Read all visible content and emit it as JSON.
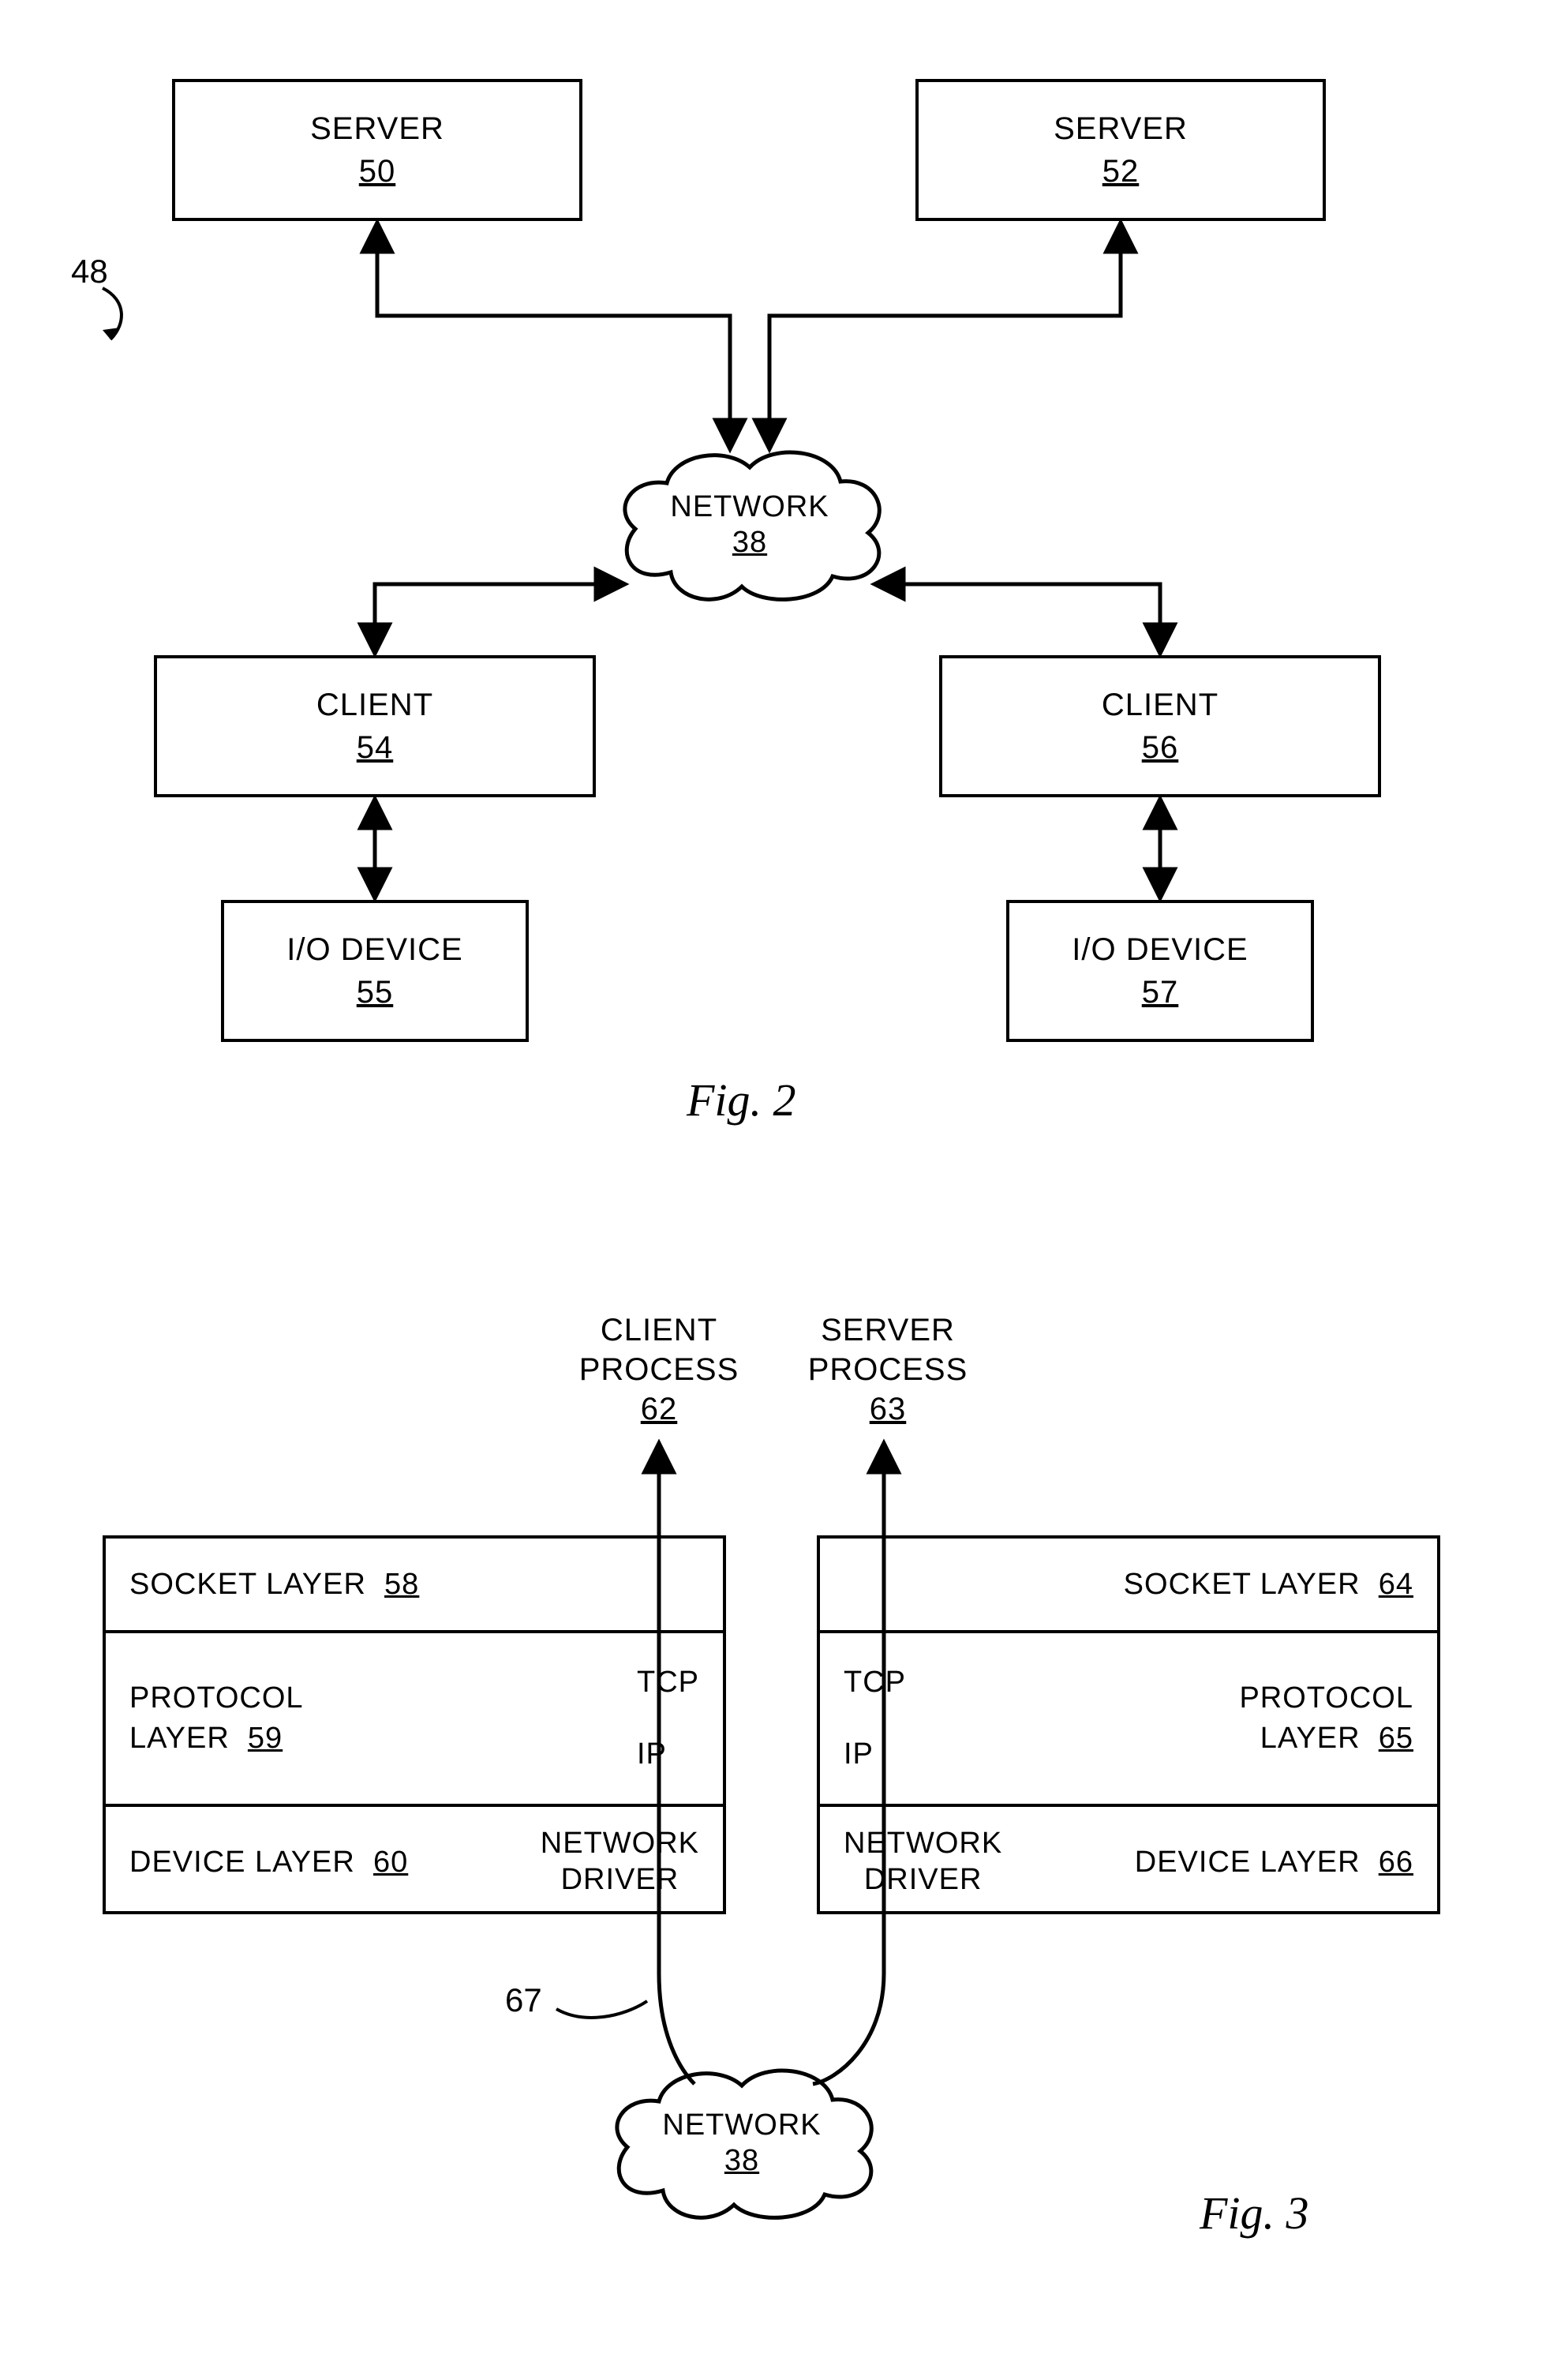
{
  "fig2": {
    "ref_label": "48",
    "server_a": {
      "title": "SERVER",
      "num": "50"
    },
    "server_b": {
      "title": "SERVER",
      "num": "52"
    },
    "network": {
      "title": "NETWORK",
      "num": "38"
    },
    "client_a": {
      "title": "CLIENT",
      "num": "54"
    },
    "client_b": {
      "title": "CLIENT",
      "num": "56"
    },
    "io_a": {
      "title": "I/O DEVICE",
      "num": "55"
    },
    "io_b": {
      "title": "I/O DEVICE",
      "num": "57"
    },
    "caption": "Fig. 2"
  },
  "fig3": {
    "client_process": {
      "title_l1": "CLIENT",
      "title_l2": "PROCESS",
      "num": "62"
    },
    "server_process": {
      "title_l1": "SERVER",
      "title_l2": "PROCESS",
      "num": "63"
    },
    "left_stack": {
      "socket": {
        "label": "SOCKET LAYER",
        "num": "58"
      },
      "protocol": {
        "label_l1": "PROTOCOL",
        "label_l2": "LAYER",
        "num": "59",
        "tcp": "TCP",
        "ip": "IP"
      },
      "device": {
        "label": "DEVICE LAYER",
        "num": "60",
        "driver_l1": "NETWORK",
        "driver_l2": "DRIVER"
      }
    },
    "right_stack": {
      "socket": {
        "label": "SOCKET LAYER",
        "num": "64"
      },
      "protocol": {
        "label_l1": "PROTOCOL",
        "label_l2": "LAYER",
        "num": "65",
        "tcp": "TCP",
        "ip": "IP"
      },
      "device": {
        "label": "DEVICE LAYER",
        "num": "66",
        "driver_l1": "NETWORK",
        "driver_l2": "DRIVER"
      }
    },
    "ref_67": "67",
    "network": {
      "title": "NETWORK",
      "num": "38"
    },
    "caption": "Fig. 3"
  }
}
